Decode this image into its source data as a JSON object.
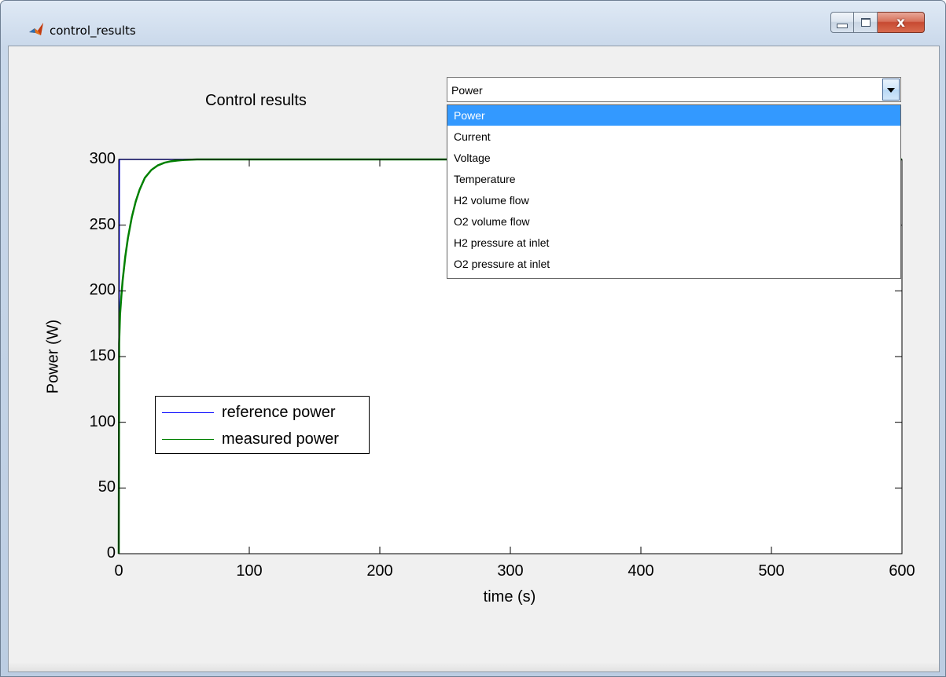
{
  "window": {
    "title": "control_results",
    "icon": "matlab-icon",
    "controls": {
      "minimize": "minimize-icon",
      "maximize": "maximize-icon",
      "close_label": "x"
    }
  },
  "panel": {
    "title": "Control results"
  },
  "dropdown": {
    "value": "Power",
    "options": [
      "Power",
      "Current",
      "Voltage",
      "Temperature",
      "H2 volume flow",
      "O2 volume flow",
      "H2 pressure at inlet",
      "O2 pressure at inlet"
    ],
    "highlighted_index": 0,
    "highlight_color": "#3399ff"
  },
  "chart_data": {
    "type": "line",
    "xlabel": "time (s)",
    "ylabel": "Power (W)",
    "xlim": [
      0,
      600
    ],
    "ylim": [
      0,
      300
    ],
    "xticks": [
      0,
      100,
      200,
      300,
      400,
      500,
      600
    ],
    "yticks": [
      0,
      50,
      100,
      150,
      200,
      250,
      300
    ],
    "legend_position": "middle-left",
    "grid": false,
    "series": [
      {
        "name": "reference power",
        "color": "#0000ff",
        "x": [
          0,
          0.5,
          600
        ],
        "y": [
          0,
          300,
          300
        ]
      },
      {
        "name": "measured power",
        "color": "#008000",
        "x": [
          0,
          0.3,
          1,
          2,
          3,
          5,
          7,
          10,
          13,
          16,
          20,
          25,
          30,
          35,
          40,
          45,
          50,
          60,
          80,
          120,
          200,
          300,
          400,
          500,
          600
        ],
        "y": [
          0,
          160,
          182,
          196,
          208,
          226,
          240,
          256,
          268,
          277,
          286,
          292,
          295.5,
          297.5,
          298.6,
          299.2,
          299.6,
          300,
          300,
          300,
          300,
          300,
          300,
          300,
          300
        ]
      }
    ]
  }
}
